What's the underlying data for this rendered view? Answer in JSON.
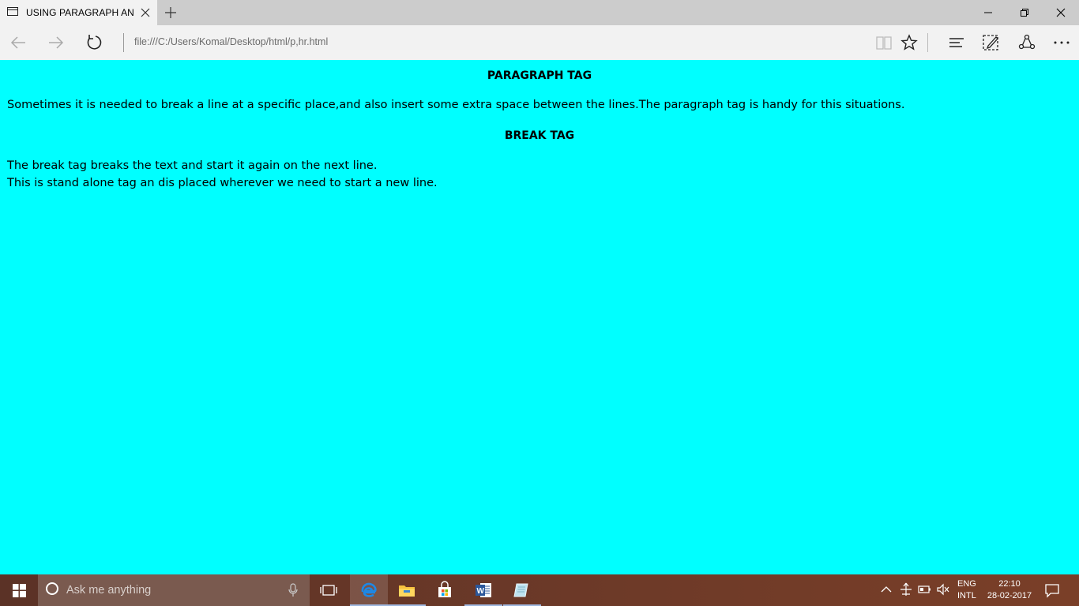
{
  "browser": {
    "tab_title": "USING PARAGRAPH AN",
    "address": "file:///C:/Users/Komal/Desktop/html/p,hr.html"
  },
  "page": {
    "heading1": "PARAGRAPH TAG",
    "paragraph1": "Sometimes it is needed to break a line at a specific place,and also insert some extra space between the lines.The paragraph tag is handy for this situations.",
    "heading2": "BREAK TAG",
    "line1": "The break tag breaks the text and start it again on the next line.",
    "line2": "This is stand alone tag an dis placed wherever we need to start a new line.",
    "background_color": "#00ffff"
  },
  "taskbar": {
    "search_placeholder": "Ask me anything",
    "apps": [
      "edge-icon",
      "file-explorer-icon",
      "store-icon",
      "word-icon",
      "notepad-icon"
    ],
    "lang_top": "ENG",
    "lang_bottom": "INTL",
    "time": "22:10",
    "date": "28-02-2017"
  }
}
